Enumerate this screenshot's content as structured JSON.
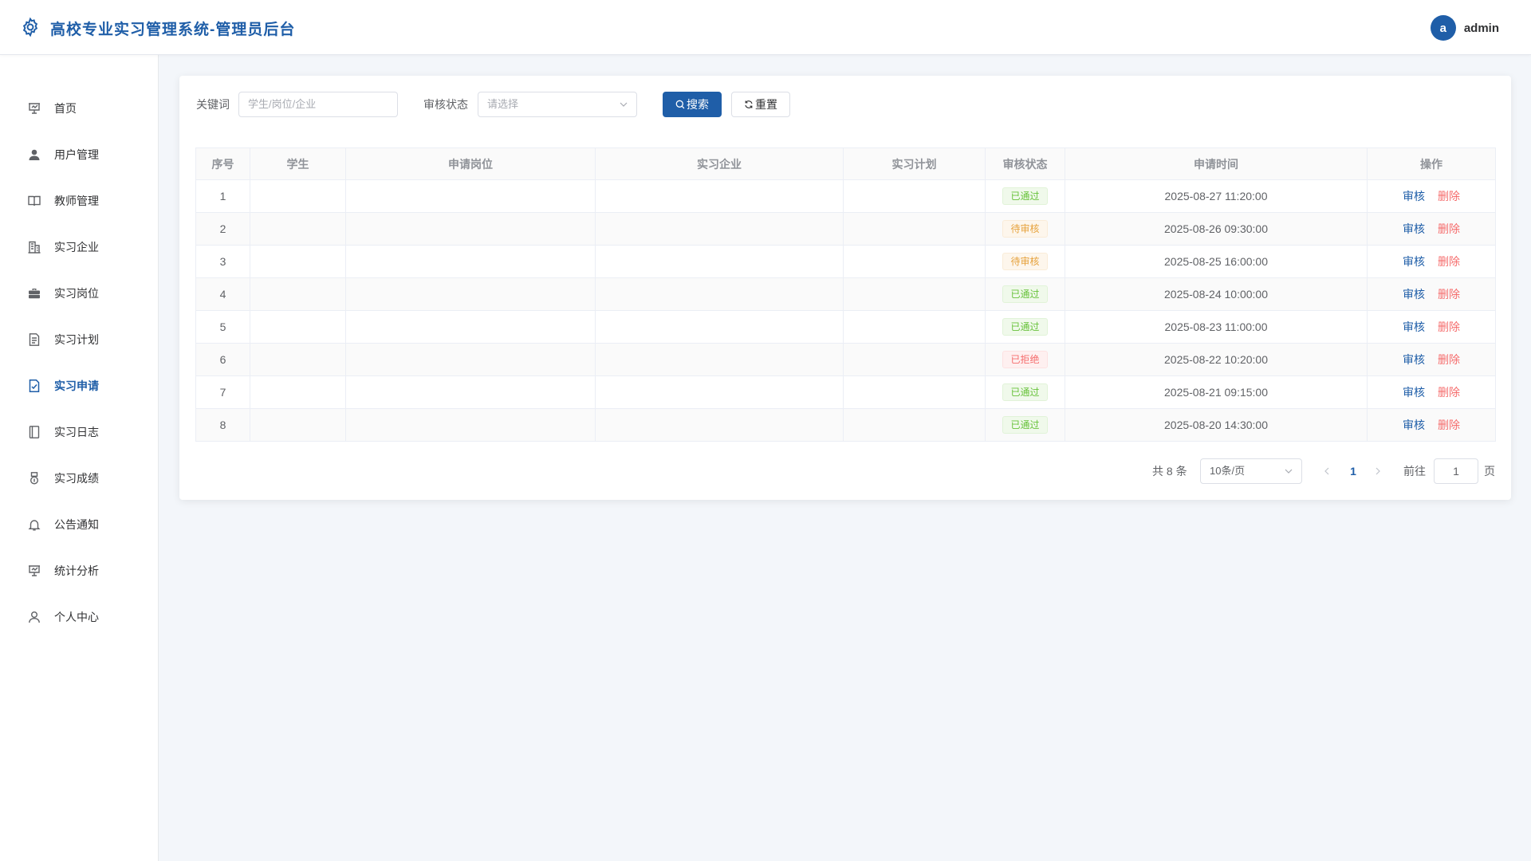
{
  "header": {
    "title": "高校专业实习管理系统-管理员后台",
    "avatar_letter": "a",
    "username": "admin"
  },
  "sidebar": {
    "items": [
      {
        "label": "首页",
        "icon": "dashboard-icon"
      },
      {
        "label": "用户管理",
        "icon": "user-icon"
      },
      {
        "label": "教师管理",
        "icon": "book-icon"
      },
      {
        "label": "实习企业",
        "icon": "building-icon"
      },
      {
        "label": "实习岗位",
        "icon": "briefcase-icon"
      },
      {
        "label": "实习计划",
        "icon": "document-icon"
      },
      {
        "label": "实习申请",
        "icon": "checked-document-icon",
        "active": true
      },
      {
        "label": "实习日志",
        "icon": "notebook-icon"
      },
      {
        "label": "实习成绩",
        "icon": "medal-icon"
      },
      {
        "label": "公告通知",
        "icon": "bell-icon"
      },
      {
        "label": "统计分析",
        "icon": "presentation-icon"
      },
      {
        "label": "个人中心",
        "icon": "user-outline-icon"
      }
    ]
  },
  "filters": {
    "keyword_label": "关键词",
    "keyword_placeholder": "学生/岗位/企业",
    "status_label": "审核状态",
    "status_placeholder": "请选择",
    "search_label": "搜索",
    "reset_label": "重置"
  },
  "table": {
    "columns": [
      "序号",
      "学生",
      "申请岗位",
      "实习企业",
      "实习计划",
      "审核状态",
      "申请时间",
      "操作"
    ],
    "actions": {
      "review": "审核",
      "delete": "删除"
    },
    "rows": [
      {
        "index": "1",
        "student": "",
        "position": "",
        "company": "",
        "plan": "",
        "status": "已通过",
        "status_type": "success",
        "time": "2025-08-27 11:20:00"
      },
      {
        "index": "2",
        "student": "",
        "position": "",
        "company": "",
        "plan": "",
        "status": "待审核",
        "status_type": "warning",
        "time": "2025-08-26 09:30:00"
      },
      {
        "index": "3",
        "student": "",
        "position": "",
        "company": "",
        "plan": "",
        "status": "待审核",
        "status_type": "warning",
        "time": "2025-08-25 16:00:00"
      },
      {
        "index": "4",
        "student": "",
        "position": "",
        "company": "",
        "plan": "",
        "status": "已通过",
        "status_type": "success",
        "time": "2025-08-24 10:00:00"
      },
      {
        "index": "5",
        "student": "",
        "position": "",
        "company": "",
        "plan": "",
        "status": "已通过",
        "status_type": "success",
        "time": "2025-08-23 11:00:00"
      },
      {
        "index": "6",
        "student": "",
        "position": "",
        "company": "",
        "plan": "",
        "status": "已拒绝",
        "status_type": "danger",
        "time": "2025-08-22 10:20:00"
      },
      {
        "index": "7",
        "student": "",
        "position": "",
        "company": "",
        "plan": "",
        "status": "已通过",
        "status_type": "success",
        "time": "2025-08-21 09:15:00"
      },
      {
        "index": "8",
        "student": "",
        "position": "",
        "company": "",
        "plan": "",
        "status": "已通过",
        "status_type": "success",
        "time": "2025-08-20 14:30:00"
      }
    ]
  },
  "pagination": {
    "total_text": "共 8 条",
    "page_size": "10条/页",
    "current_page": "1",
    "goto_label": "前往",
    "goto_value": "1",
    "page_unit": "页"
  },
  "colors": {
    "primary": "#1f5ea8",
    "success": "#67c23a",
    "warning": "#e6a23c",
    "danger": "#f56c6c"
  }
}
